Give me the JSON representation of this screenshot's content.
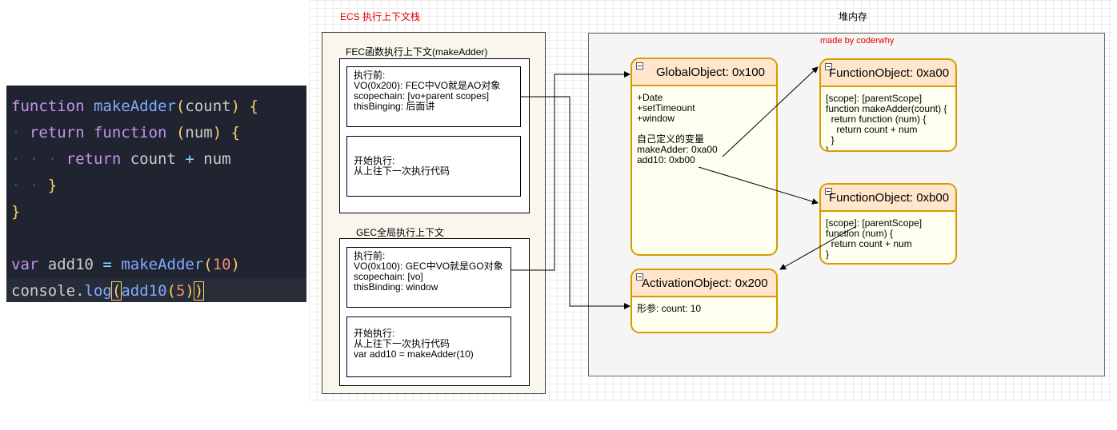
{
  "code": {
    "lines": [
      [
        {
          "t": "function",
          "c": "kw"
        },
        {
          "t": " ",
          "c": "var"
        },
        {
          "t": "makeAdder",
          "c": "fn"
        },
        {
          "t": "(",
          "c": "pn"
        },
        {
          "t": "count",
          "c": "var"
        },
        {
          "t": ")",
          "c": "pn"
        },
        {
          "t": " ",
          "c": "var"
        },
        {
          "t": "{",
          "c": "pn"
        }
      ],
      [
        {
          "t": "· ",
          "c": "ws"
        },
        {
          "t": "return",
          "c": "kw"
        },
        {
          "t": " ",
          "c": "ws"
        },
        {
          "t": "function",
          "c": "kw"
        },
        {
          "t": " ",
          "c": "ws"
        },
        {
          "t": "(",
          "c": "pn"
        },
        {
          "t": "num",
          "c": "var"
        },
        {
          "t": ")",
          "c": "pn"
        },
        {
          "t": " ",
          "c": "ws"
        },
        {
          "t": "{",
          "c": "pn"
        }
      ],
      [
        {
          "t": "· · · ",
          "c": "ws"
        },
        {
          "t": "return",
          "c": "kw"
        },
        {
          "t": " count ",
          "c": "var"
        },
        {
          "t": "+",
          "c": "op"
        },
        {
          "t": " num",
          "c": "var"
        }
      ],
      [
        {
          "t": "· · ",
          "c": "ws"
        },
        {
          "t": "}",
          "c": "pn"
        }
      ],
      [
        {
          "t": "}",
          "c": "pn"
        }
      ],
      [],
      [
        {
          "t": "var",
          "c": "kw"
        },
        {
          "t": " add10 ",
          "c": "var"
        },
        {
          "t": "=",
          "c": "op"
        },
        {
          "t": " ",
          "c": "var"
        },
        {
          "t": "makeAdder",
          "c": "fn"
        },
        {
          "t": "(",
          "c": "pn"
        },
        {
          "t": "10",
          "c": "num"
        },
        {
          "t": ")",
          "c": "pn"
        }
      ],
      [
        {
          "t": "console",
          "c": "var"
        },
        {
          "t": ".",
          "c": "op"
        },
        {
          "t": "log",
          "c": "prop"
        },
        {
          "t": "(",
          "c": "mp"
        },
        {
          "t": "add10",
          "c": "fn"
        },
        {
          "t": "(",
          "c": "pn"
        },
        {
          "t": "5",
          "c": "num"
        },
        {
          "t": ")",
          "c": "pn"
        },
        {
          "t": ")",
          "c": "mp"
        }
      ]
    ]
  },
  "diagram": {
    "ecs_title": "ECS 执行上下文栈",
    "heap_title": "堆内存",
    "watermark": "made by coderwhy",
    "fec": {
      "title": "FEC函数执行上下文(makeAdder)",
      "before_lines": [
        "执行前:",
        "VO(0x200): FEC中VO就是AO对象",
        "scopechain: [vo+parent scopes]",
        "thisBinging: 后面讲"
      ],
      "exec_lines": [
        "开始执行:",
        "从上往下一次执行代码"
      ]
    },
    "gec": {
      "title": "GEC全局执行上下文",
      "before_lines": [
        "执行前:",
        "VO(0x100): GEC中VO就是GO对象",
        "scopechain: [vo]",
        "thisBinding: window"
      ],
      "exec_lines": [
        "开始执行:",
        "从上往下一次执行代码",
        "var add10 = makeAdder(10)"
      ]
    },
    "global_object": {
      "title": "GlobalObject: 0x100",
      "lines": [
        "+Date",
        "+setTimeount",
        "+window",
        "",
        "自己定义的变量",
        "makeAdder: 0xa00",
        "add10: 0xb00"
      ]
    },
    "function_a00": {
      "title": "FunctionObject: 0xa00",
      "lines": [
        "[scope]: [parentScope]",
        "function makeAdder(count) {",
        "  return function (num) {",
        "    return count + num",
        "  }",
        "}"
      ]
    },
    "function_b00": {
      "title": "FunctionObject: 0xb00",
      "lines": [
        "[scope]: [parentScope]",
        "function (num) {",
        "  return count + num",
        "}"
      ]
    },
    "activation_object": {
      "title": "ActivationObject: 0x200",
      "lines": [
        "形参: count: 10"
      ]
    }
  },
  "colors": {
    "editor_bg": "#1f2430",
    "keyword": "#c792ea",
    "function_name": "#82aaff",
    "bracket": "#ffcc66",
    "number": "#f78c6c",
    "object_fill": "#ffe6cc",
    "object_border": "#d79b00",
    "watermark": "#e60000"
  }
}
